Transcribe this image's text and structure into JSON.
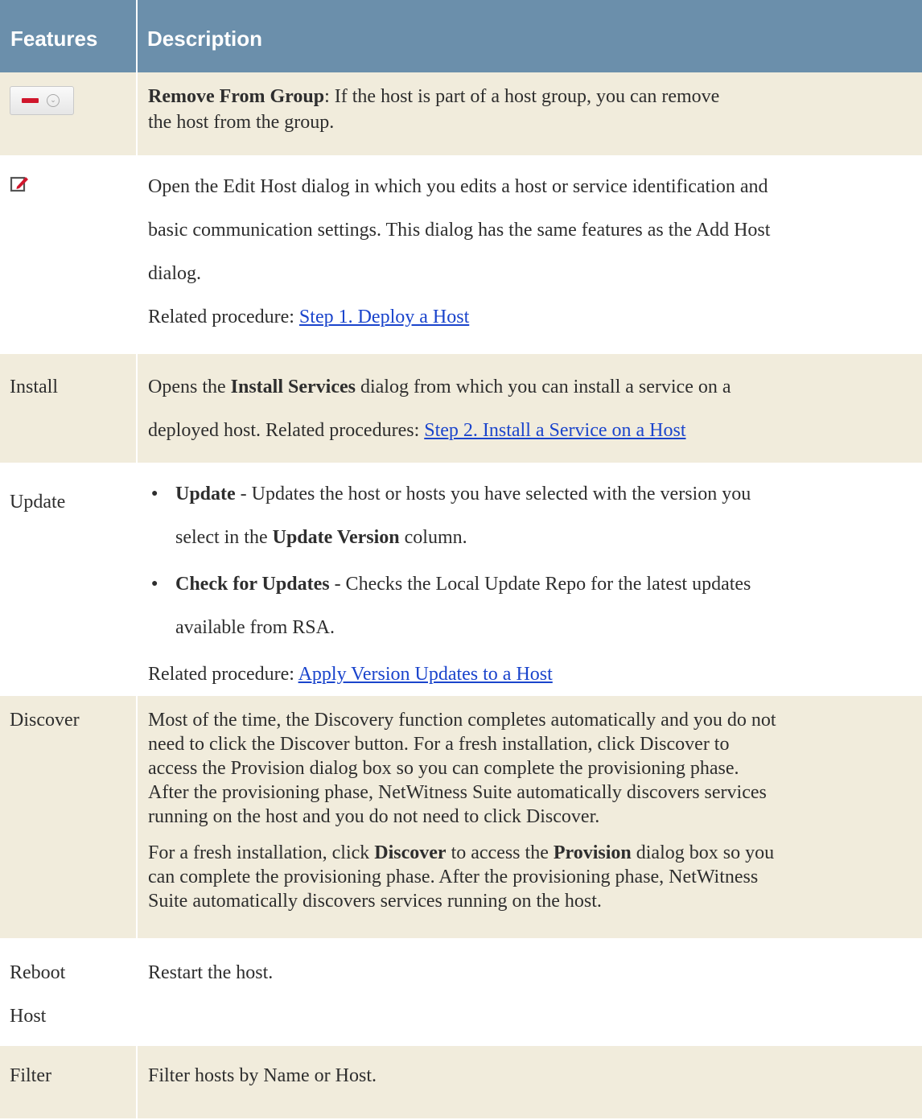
{
  "header": {
    "col1": "Features",
    "col2": "Description"
  },
  "rows": {
    "remove": {
      "icon": "remove-from-group-icon",
      "bold": "Remove From Group",
      "text1": ": If the host is part of a host group, you can remove",
      "text2": "the host from the group."
    },
    "edit": {
      "icon": "edit-icon",
      "line1": "Open the Edit Host dialog in which you edits a host or service identification and",
      "line2": "basic communication settings. This dialog has the same features as the Add Host",
      "line3": "dialog.",
      "related_label": "Related procedure: ",
      "related_link": "Step 1. Deploy a Host "
    },
    "install": {
      "feature": "Install",
      "t1": "Opens the ",
      "bold1": "Install Services",
      "t2": " dialog from which you can install a service on a",
      "t3": "deployed host. Related procedures: ",
      "link": " Step 2. Install a Service on a Host"
    },
    "update": {
      "feature": "Update",
      "b1_bold": "Update",
      "b1_t1": " - Updates the host or hosts you have selected with the version you",
      "b1_t2": "select in the ",
      "b1_bold2": "Update Version",
      "b1_t3": " column.",
      "b2_bold": "Check for Updates",
      "b2_t1": " - Checks the Local Update Repo for the latest updates",
      "b2_t2": "available from RSA.",
      "related_label": "Related procedure: ",
      "related_link": "Apply Version Updates to a Host"
    },
    "discover": {
      "feature": "Discover",
      "p1_l1": "Most of the time, the Discovery function completes automatically and you do not",
      "p1_l2": "need to click the Discover button. For a fresh installation, click Discover to",
      "p1_l3": "access the Provision dialog box so you can complete the provisioning phase.",
      "p1_l4": "After the provisioning phase, NetWitness Suite automatically discovers services",
      "p1_l5": "running on the host and you do not need to click Discover.",
      "p2_t1": "For a fresh installation, click ",
      "p2_b1": "Discover",
      "p2_t2": " to access the ",
      "p2_b2": "Provision",
      "p2_t3": " dialog box so you",
      "p2_l2": "can complete the provisioning phase. After the provisioning phase, NetWitness",
      "p2_l3": "Suite automatically discovers services running on the host."
    },
    "reboot": {
      "feature_l1": "Reboot",
      "feature_l2": "Host",
      "desc": "Restart the host."
    },
    "filter": {
      "feature": "Filter",
      "desc": "Filter hosts by Name or Host."
    }
  },
  "colors": {
    "header_bg": "#6b8fab",
    "stripe_bg": "#f1ecdc",
    "link": "#1a44cc"
  }
}
